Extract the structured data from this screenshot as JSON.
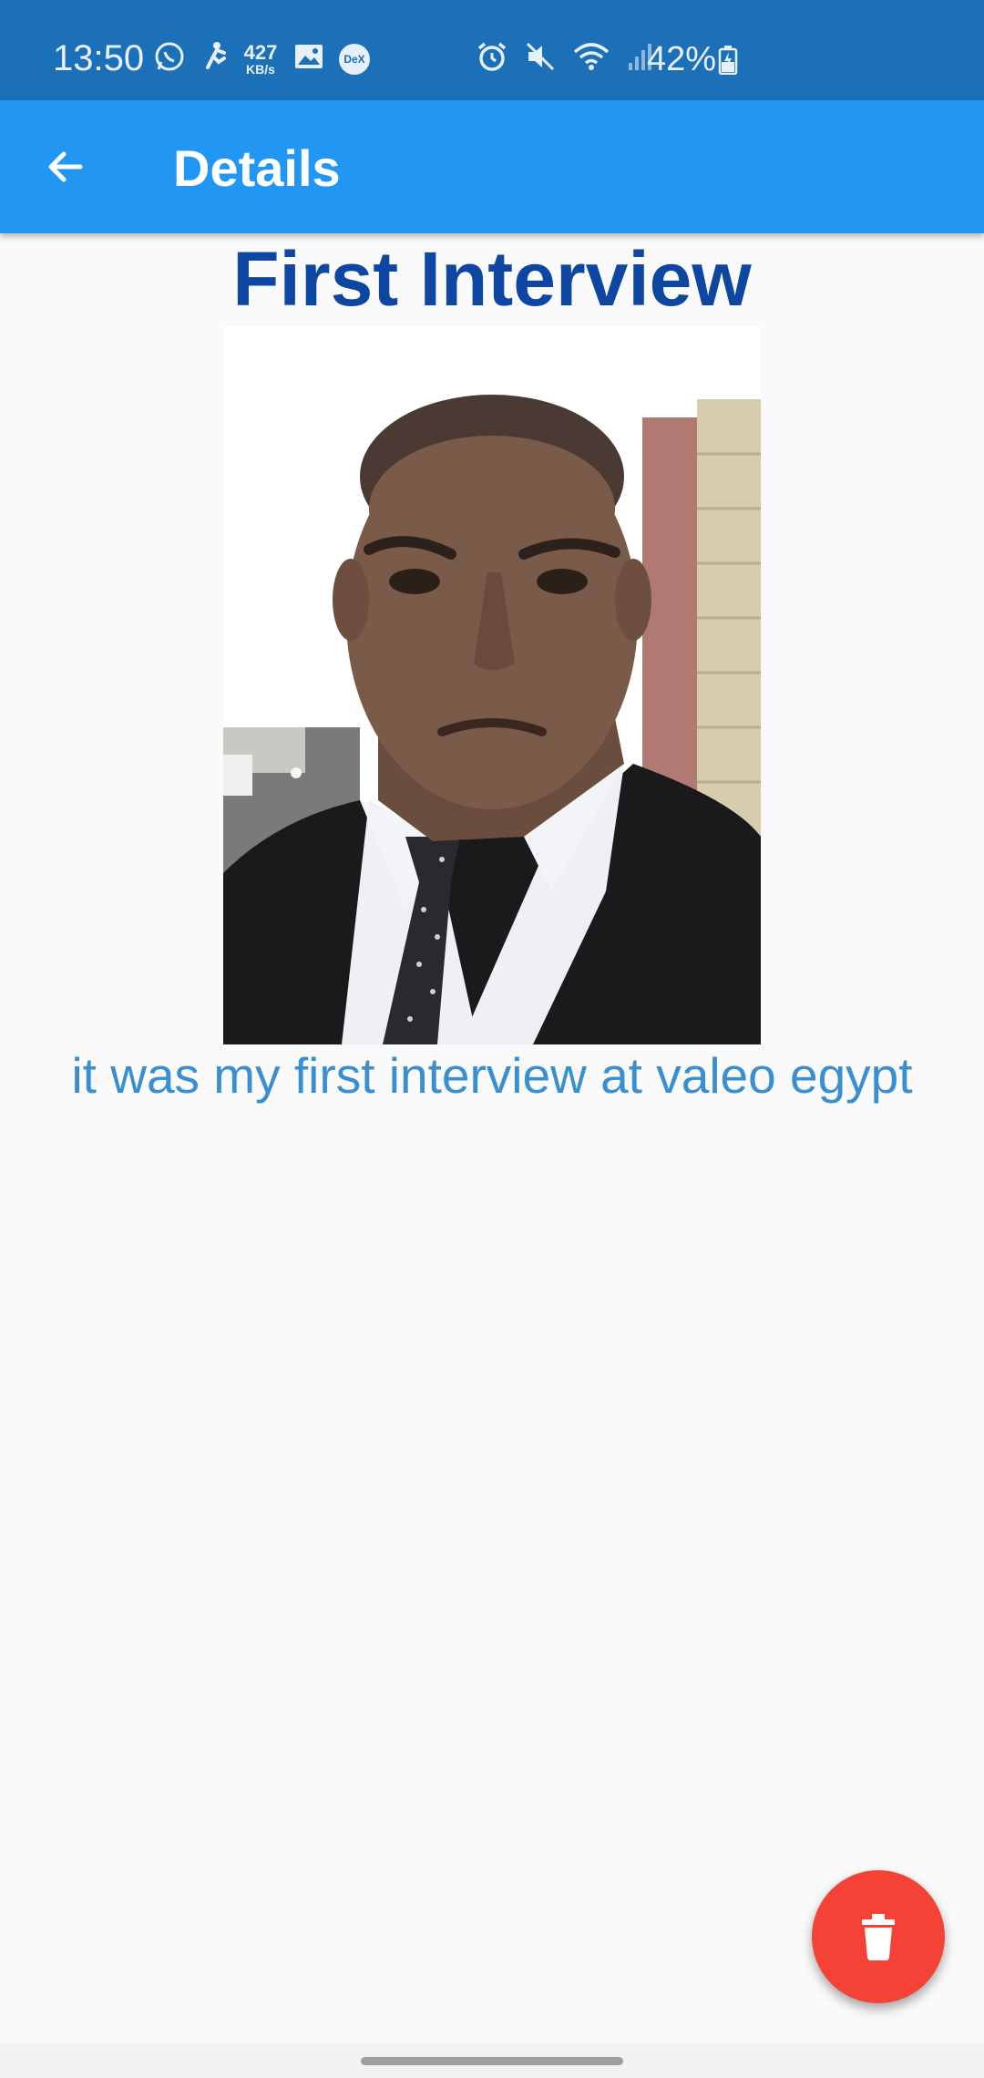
{
  "status_bar": {
    "time": "13:50",
    "net_speed_value": "427",
    "net_speed_unit": "KB/s",
    "dex_label": "DeX",
    "battery": "42%",
    "icons_left": [
      "whatsapp-icon",
      "runner-icon",
      "image-icon",
      "dex-icon"
    ],
    "icons_right": [
      "alarm-icon",
      "mute-icon",
      "wifi-icon",
      "signal-icon",
      "battery-charging-icon"
    ]
  },
  "app_bar": {
    "title": "Details",
    "back_icon": "arrow-back-icon"
  },
  "content": {
    "title": "First Interview",
    "caption": "it was my first interview at valeo egypt"
  },
  "fab": {
    "icon": "trash-icon"
  },
  "colors": {
    "status_bar": "#1c70b8",
    "app_bar": "#2196f3",
    "title": "#0d47a1",
    "caption": "#3a8fd0",
    "fab": "#f44336"
  }
}
